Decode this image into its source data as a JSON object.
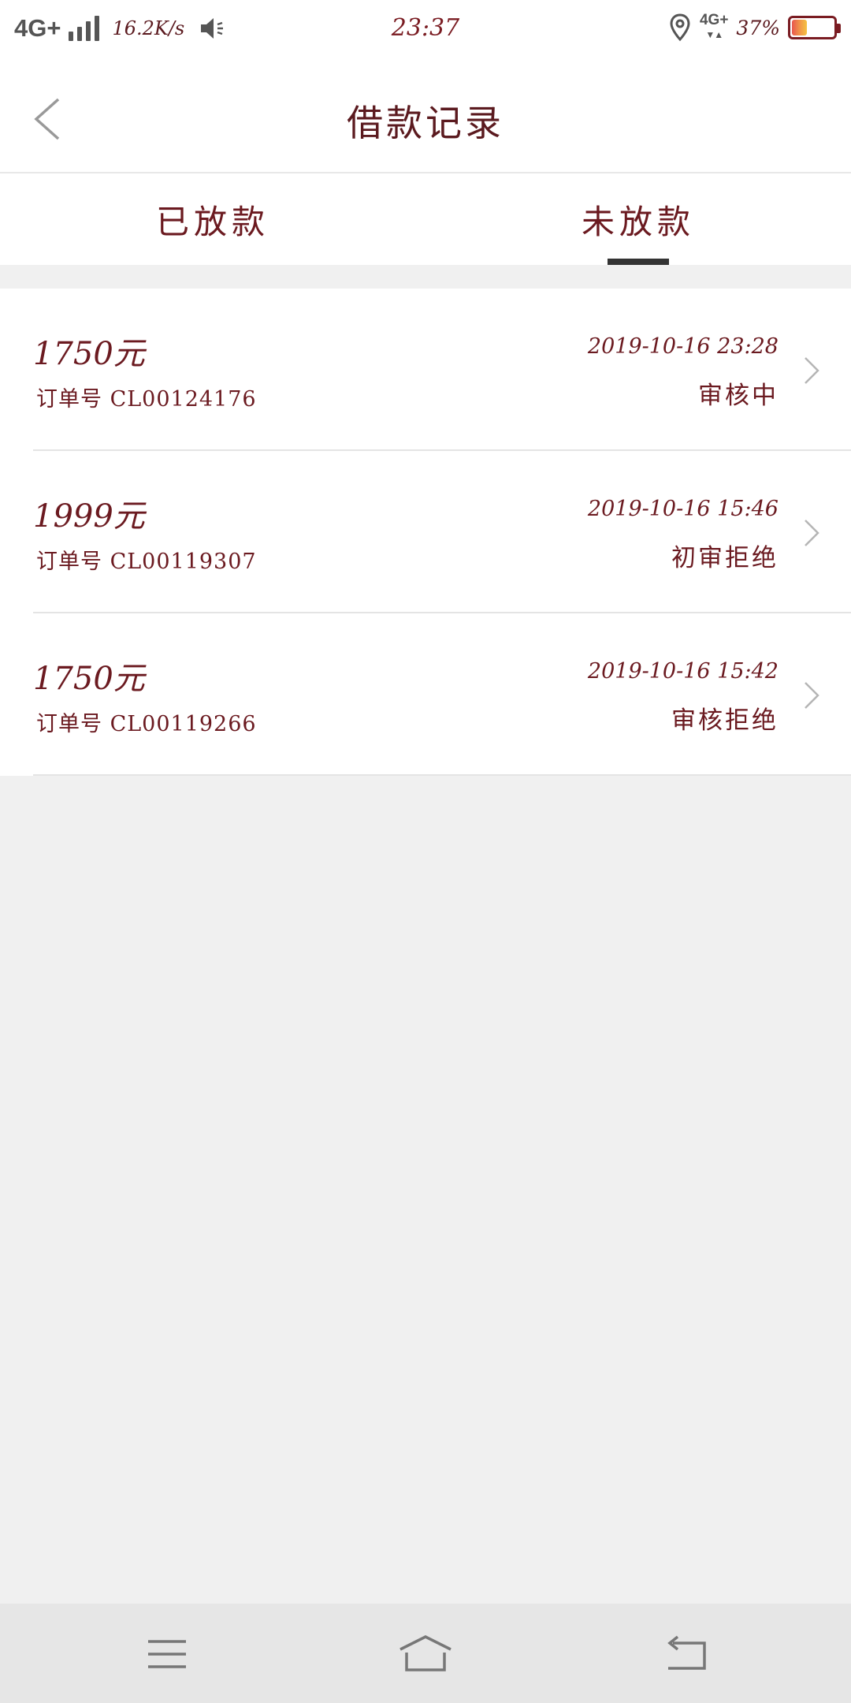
{
  "status_bar": {
    "network": "4G+",
    "speed": "16.2K/s",
    "time": "23:37",
    "data_network": "4G+",
    "battery_percent": "37%",
    "battery_level": 0.37
  },
  "header": {
    "title": "借款记录"
  },
  "tabs": [
    {
      "label": "已放款",
      "selected": false
    },
    {
      "label": "未放款",
      "selected": true
    }
  ],
  "records": [
    {
      "amount": "1750元",
      "order": "订单号 CL00124176",
      "datetime": "2019-10-16 23:28",
      "status": "审核中"
    },
    {
      "amount": "1999元",
      "order": "订单号 CL00119307",
      "datetime": "2019-10-16 15:46",
      "status": "初审拒绝"
    },
    {
      "amount": "1750元",
      "order": "订单号 CL00119266",
      "datetime": "2019-10-16 15:42",
      "status": "审核拒绝"
    }
  ],
  "nav_bar": {
    "icons": [
      "menu-icon",
      "home-icon",
      "back-icon"
    ]
  },
  "colors": {
    "text_primary": "#6b1a20",
    "tab_indicator": "#333333",
    "background": "#f0f0f0"
  }
}
